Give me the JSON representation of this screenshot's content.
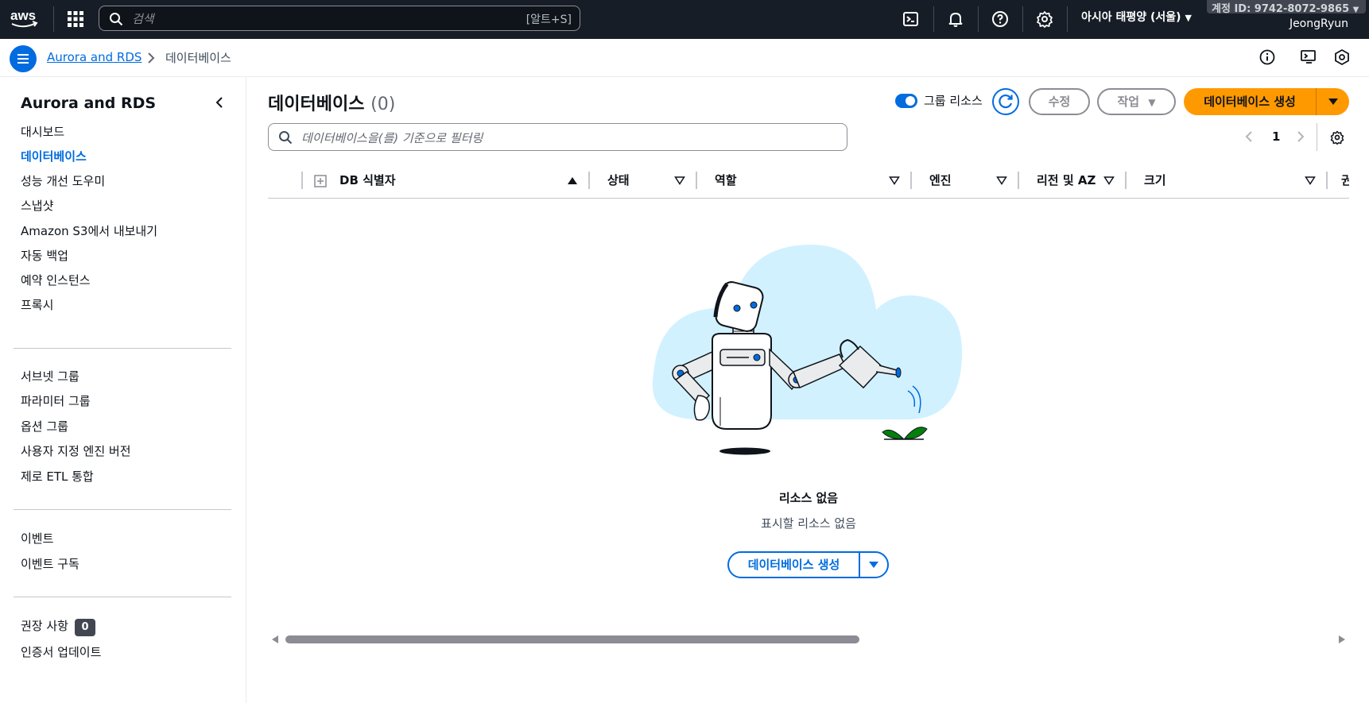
{
  "topnav": {
    "logo_text": "aws",
    "search_placeholder": "검색",
    "search_shortcut": "[알트+S]",
    "region": "아시아 태평양 (서울)",
    "account_id": "계정 ID: 9742-8072-9865",
    "user": "JeongRyun"
  },
  "breadcrumb": {
    "root": "Aurora and RDS",
    "current": "데이터베이스"
  },
  "sidebar": {
    "title": "Aurora and RDS",
    "group1": [
      "대시보드",
      "데이터베이스",
      "성능 개선 도우미",
      "스냅샷",
      "Amazon S3에서 내보내기",
      "자동 백업",
      "예약 인스턴스",
      "프록시"
    ],
    "group2": [
      "서브넷 그룹",
      "파라미터 그룹",
      "옵션 그룹",
      "사용자 지정 엔진 버전",
      "제로 ETL 통합"
    ],
    "group3": [
      "이벤트",
      "이벤트 구독"
    ],
    "group4": {
      "recommendations": "권장 사항",
      "recommendations_count": "0",
      "cert_update": "인증서 업데이트"
    },
    "active": "데이터베이스"
  },
  "main": {
    "title": "데이터베이스",
    "count": "(0)",
    "group_resources_label": "그룹 리소스",
    "group_resources_on": true,
    "modify_label": "수정",
    "actions_label": "작업",
    "create_label": "데이터베이스 생성",
    "filter_placeholder": "데이터베이스을(를) 기준으로 필터링",
    "page": "1",
    "columns": [
      "DB 식별자",
      "상태",
      "역할",
      "엔진",
      "리전 및 AZ",
      "크기",
      "권"
    ],
    "empty_title": "리소스 없음",
    "empty_sub": "표시할 리소스 없음",
    "empty_create_label": "데이터베이스 생성"
  },
  "colors": {
    "nav_bg": "#161d26",
    "accent_blue": "#006ce0",
    "primary_orange": "#ff9900"
  }
}
